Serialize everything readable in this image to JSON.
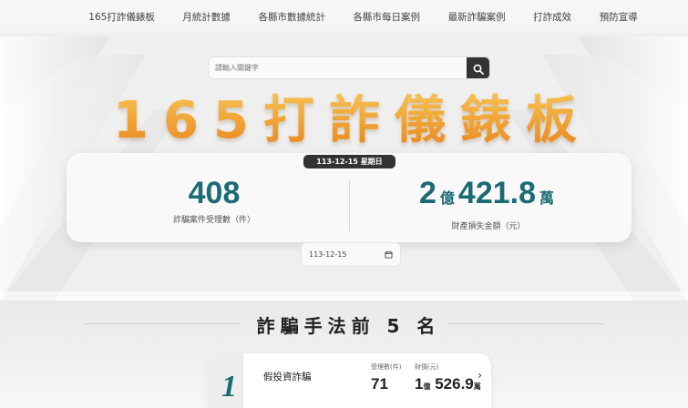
{
  "nav": {
    "items": [
      {
        "label": "165打詐儀錶板"
      },
      {
        "label": "月統計數據"
      },
      {
        "label": "各縣市數據統計"
      },
      {
        "label": "各縣市每日案例"
      },
      {
        "label": "最新詐騙案例"
      },
      {
        "label": "打詐成效"
      },
      {
        "label": "預防宣導"
      }
    ]
  },
  "search": {
    "placeholder": "請輸入關鍵字",
    "icon": "search-icon"
  },
  "hero": {
    "title": "165打詐儀錶板",
    "date_label": "113-12-15 星期日"
  },
  "stats": {
    "cases": {
      "value": "408",
      "label": "詐騙案件受理數（件）"
    },
    "loss": {
      "part1": "2",
      "unit1": "億",
      "part2": "421.8",
      "unit2": "萬",
      "label": "財產損失金額（元）"
    }
  },
  "date_picker": {
    "value": "113-12-15",
    "icon": "calendar-icon"
  },
  "top5": {
    "heading": "詐騙手法前 5 名",
    "items": [
      {
        "rank": "1",
        "name": "假投資詐騙",
        "cases_label": "受理數(件)",
        "cases_value": "71",
        "loss_label": "財損(元)",
        "loss_part1": "1",
        "loss_unit1": "億",
        "loss_part2": "526.9",
        "loss_unit2": "萬"
      }
    ]
  },
  "colors": {
    "accent_teal": "#1a6b73",
    "title_orange": "#f0a032",
    "dark": "#333333"
  }
}
